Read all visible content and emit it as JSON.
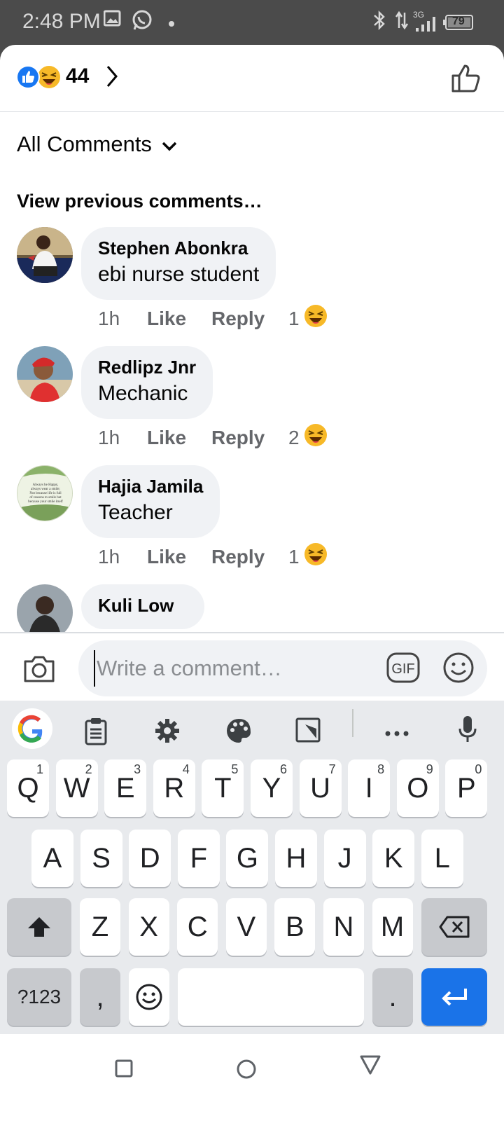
{
  "status_bar": {
    "time": "2:48 PM",
    "network": "3G",
    "battery": "79",
    "icons": [
      "gallery-icon",
      "whatsapp-icon",
      "dot-icon",
      "bluetooth-icon",
      "data-arrows-icon",
      "signal-icon",
      "battery-icon"
    ]
  },
  "reactions": {
    "count": "44",
    "icons": [
      "like-reaction-icon",
      "haha-reaction-icon"
    ]
  },
  "filter": {
    "label": "All Comments"
  },
  "view_previous": "View previous comments…",
  "comments": [
    {
      "name": "Stephen Abonkra",
      "text": "ebi nurse student",
      "time": "1h",
      "like": "Like",
      "reply": "Reply",
      "reaction_count": "1"
    },
    {
      "name": "Redlipz Jnr",
      "text": "Mechanic",
      "time": "1h",
      "like": "Like",
      "reply": "Reply",
      "reaction_count": "2"
    },
    {
      "name": "Hajia Jamila",
      "text": "Teacher",
      "time": "1h",
      "like": "Like",
      "reply": "Reply",
      "reaction_count": "1"
    },
    {
      "name": "Kuli Low",
      "text": "",
      "time": "",
      "like": "",
      "reply": "",
      "reaction_count": ""
    }
  ],
  "avatar3_text": "Always be Happy, always wear a smile; Not because life is full of reasons to smile but because your smile itself is a reason for many others to smile.",
  "composer": {
    "placeholder": "Write a comment…",
    "gif_label": "GIF"
  },
  "keyboard": {
    "row1": [
      {
        "key": "Q",
        "sup": "1"
      },
      {
        "key": "W",
        "sup": "2"
      },
      {
        "key": "E",
        "sup": "3"
      },
      {
        "key": "R",
        "sup": "4"
      },
      {
        "key": "T",
        "sup": "5"
      },
      {
        "key": "Y",
        "sup": "6"
      },
      {
        "key": "U",
        "sup": "7"
      },
      {
        "key": "I",
        "sup": "8"
      },
      {
        "key": "O",
        "sup": "9"
      },
      {
        "key": "P",
        "sup": "0"
      }
    ],
    "row2": [
      "A",
      "S",
      "D",
      "F",
      "G",
      "H",
      "J",
      "K",
      "L"
    ],
    "row3": [
      "Z",
      "X",
      "C",
      "V",
      "B",
      "N",
      "M"
    ],
    "symbols_label": "?123",
    "comma": ",",
    "period": "."
  },
  "colors": {
    "facebook_blue": "#1877f2",
    "haha_yellow": "#f7b928",
    "keyboard_enter": "#1a73e8",
    "bubble_bg": "#f0f2f5",
    "meta_gray": "#65676b"
  }
}
